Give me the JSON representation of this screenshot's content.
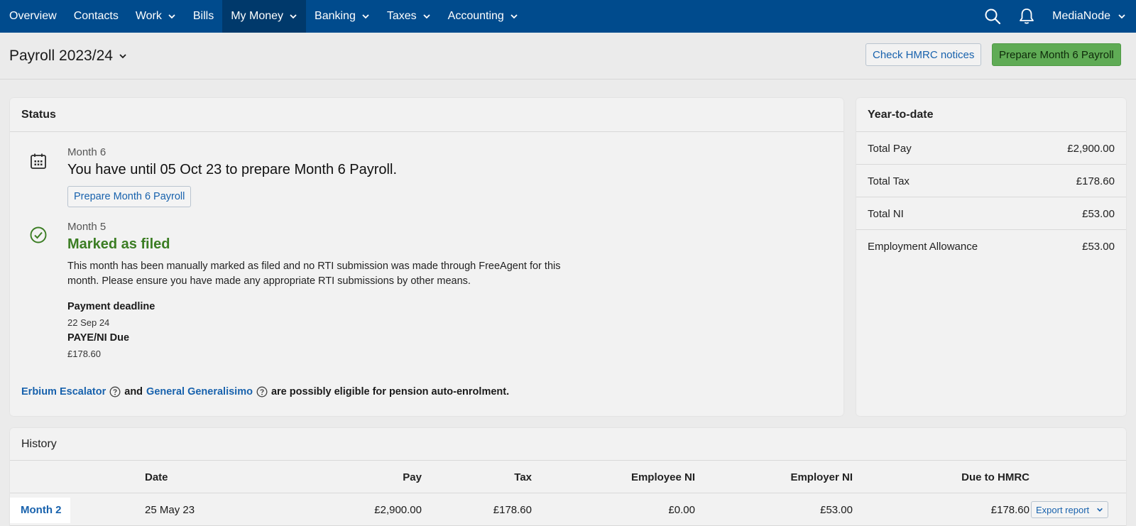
{
  "nav": {
    "items": [
      {
        "label": "Overview",
        "dropdown": false
      },
      {
        "label": "Contacts",
        "dropdown": false
      },
      {
        "label": "Work",
        "dropdown": true
      },
      {
        "label": "Bills",
        "dropdown": false
      },
      {
        "label": "My Money",
        "dropdown": true,
        "active": true
      },
      {
        "label": "Banking",
        "dropdown": true
      },
      {
        "label": "Taxes",
        "dropdown": true
      },
      {
        "label": "Accounting",
        "dropdown": true
      }
    ],
    "user": "MediaNode",
    "icons": [
      "search-icon",
      "bell-icon",
      "chevron-down-icon"
    ]
  },
  "header": {
    "title": "Payroll 2023/24",
    "check_button": "Check HMRC notices",
    "prepare_button": "Prepare Month 6 Payroll"
  },
  "status": {
    "title": "Status",
    "upcoming": {
      "month": "Month 6",
      "heading": "You have until 05 Oct 23 to prepare Month 6 Payroll.",
      "button": "Prepare Month 6 Payroll",
      "icon": "calendar-icon"
    },
    "filed": {
      "month": "Month 5",
      "heading": "Marked as filed",
      "description": "This month has been manually marked as filed and no RTI submission was made through FreeAgent for this month. Please ensure you have made any appropriate RTI submissions by other means.",
      "payment_deadline_label": "Payment deadline",
      "payment_deadline_value": "22 Sep 24",
      "paye_label": "PAYE/NI Due",
      "paye_value": "£178.60",
      "icon": "check-circle-icon"
    },
    "pension": {
      "name1": "Erbium Escalator",
      "and": "and",
      "name2": "General Generalisimo",
      "text": "are possibly eligible for pension auto-enrolment."
    }
  },
  "ytd": {
    "title": "Year-to-date",
    "rows": [
      {
        "label": "Total Pay",
        "value": "£2,900.00"
      },
      {
        "label": "Total Tax",
        "value": "£178.60"
      },
      {
        "label": "Total NI",
        "value": "£53.00"
      },
      {
        "label": "Employment Allowance",
        "value": "£53.00"
      }
    ]
  },
  "history": {
    "title": "History",
    "columns": {
      "date": "Date",
      "pay": "Pay",
      "tax": "Tax",
      "employee_ni": "Employee NI",
      "employer_ni": "Employer NI",
      "due": "Due to HMRC"
    },
    "rows": [
      {
        "month": "Month 2",
        "date": "25 May 23",
        "pay": "£2,900.00",
        "tax": "£178.60",
        "employee_ni": "£0.00",
        "employer_ni": "£53.00",
        "due": "£178.60",
        "export": "Export report"
      }
    ]
  },
  "colors": {
    "nav_bg": "#004b8d",
    "nav_active": "#00396b",
    "link": "#1862ad",
    "green_button": "#5fab55",
    "filed_green": "#3b7d23"
  }
}
